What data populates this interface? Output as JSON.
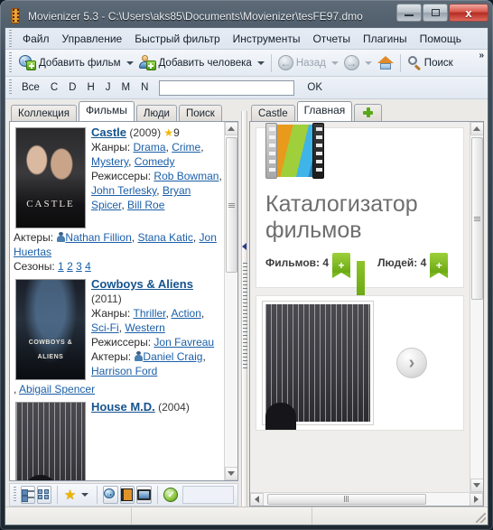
{
  "window": {
    "title": "Movienizer 5.3 - C:\\Users\\aks85\\Documents\\Movienizer\\tesFE97.dmo",
    "app_icon": "film-reel-icon",
    "minimize_label": "",
    "maximize_label": "",
    "close_label": "x"
  },
  "menu": {
    "items": [
      {
        "label": "Файл",
        "accel": ""
      },
      {
        "label": "Управление",
        "accel": "У"
      },
      {
        "label": "Быстрый фильтр",
        "accel": "Б"
      },
      {
        "label": "Инструменты",
        "accel": "И"
      },
      {
        "label": "Отчеты",
        "accel": "О"
      },
      {
        "label": "Плагины",
        "accel": "а"
      },
      {
        "label": "Помощь",
        "accel": ""
      }
    ]
  },
  "toolbar": {
    "add_movie": "Добавить фильм",
    "add_person": "Добавить человека",
    "back": "Назад",
    "forward": "",
    "home": "",
    "search": "Поиск",
    "overflow": "»"
  },
  "quick_filter": {
    "letters": [
      "Все",
      "C",
      "D",
      "H",
      "J",
      "M",
      "N"
    ],
    "input_value": "",
    "input_placeholder": "",
    "ok_label": "OK"
  },
  "left_tabs": [
    {
      "label": "Коллекция",
      "active": false
    },
    {
      "label": "Фильмы",
      "active": true
    },
    {
      "label": "Люди",
      "active": false
    },
    {
      "label": "Поиск",
      "active": false
    }
  ],
  "right_tabs": [
    {
      "label": "Castle",
      "active": false
    },
    {
      "label": "Главная",
      "active": true
    },
    {
      "label": "",
      "active": false,
      "icon": "plus-icon"
    }
  ],
  "movies": [
    {
      "title": "Castle",
      "year": "(2009)",
      "rating": "9",
      "rating_icon": "star-icon",
      "poster": "castle-poster",
      "genres_label": "Жанры:",
      "genres": [
        "Drama",
        "Crime",
        "Mystery",
        "Comedy"
      ],
      "directors_label": "Режиссеры:",
      "directors": [
        "Rob Bowman",
        "John Terlesky",
        "Bryan Spicer",
        "Bill Roe"
      ],
      "actors_label": "Актеры:",
      "actors": [
        "Nathan Fillion",
        "Stana Katic",
        "Jon Huertas"
      ],
      "seasons_label": "Сезоны:",
      "seasons": [
        "1",
        "2",
        "3",
        "4"
      ]
    },
    {
      "title": "Cowboys & Aliens",
      "year": "(2011)",
      "rating": "",
      "poster": "cowboys-aliens-poster",
      "genres_label": "Жанры:",
      "genres": [
        "Thriller",
        "Action",
        "Sci-Fi",
        "Western"
      ],
      "directors_label": "Режиссеры:",
      "directors": [
        "Jon Favreau"
      ],
      "actors_label": "Актеры:",
      "actors": [
        "Daniel Craig",
        "Harrison Ford",
        "Abigail Spencer"
      ],
      "seasons_label": "",
      "seasons": []
    },
    {
      "title": "House M.D.",
      "year": "(2004)",
      "rating": "",
      "poster": "house-md-poster",
      "genres_label": "",
      "genres": [],
      "directors_label": "",
      "directors": [],
      "actors_label": "",
      "actors": [],
      "seasons_label": "",
      "seasons": []
    }
  ],
  "catalog": {
    "logo_icon": "film-strip-logo",
    "title": "Каталогизатор фильмов",
    "counters": [
      {
        "label": "Фильмов: 4",
        "add_icon": "plus-tag-icon"
      },
      {
        "label": "Людей: 4",
        "add_icon": "plus-tag-icon"
      }
    ],
    "featured_poster": "house-md-poster",
    "next_arrow": "›",
    "next_arrow_icon": "chevron-right-icon"
  },
  "bottom_toolbar": {
    "view_details": "list-details-icon",
    "view_tiles": "list-tiles-icon",
    "favorites": "star-icon",
    "favorites_caret": "chevron-down-icon",
    "movies_view": "film-disc-icon",
    "film_view": "film-strip-icon",
    "monitor_view": "monitor-icon",
    "status_ok": "check-circle-icon"
  },
  "statusbar": {
    "cell1": "",
    "cell2": "",
    "cell3": "",
    "resize_grip": "resize-grip-icon"
  },
  "colors": {
    "link": "#1b5fa8",
    "title_link": "#15538f",
    "accent_green": "#6aa812",
    "star": "#f0b400",
    "close_red": "#b22c22"
  }
}
